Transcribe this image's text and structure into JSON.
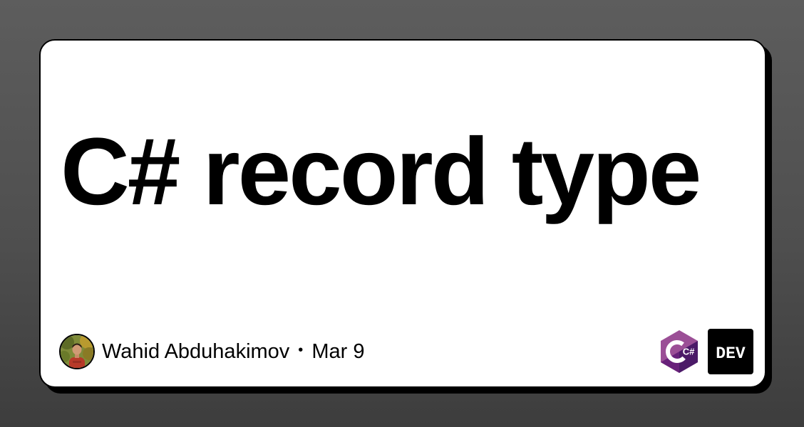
{
  "post": {
    "title": "C# record type"
  },
  "author": {
    "name": "Wahid Abduhakimov",
    "separator": "•",
    "date": "Mar 9"
  },
  "logos": {
    "csharp_text": "C#",
    "dev_text": "DEV",
    "csharp_colors": [
      "#9b4f96",
      "#68217a",
      "#4b1a68"
    ],
    "dev_color": "#000000"
  }
}
